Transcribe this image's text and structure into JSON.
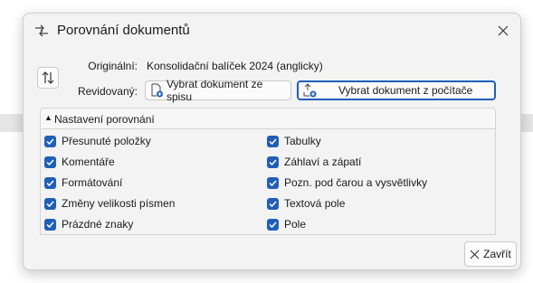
{
  "dialog": {
    "title": "Porovnání dokumentů",
    "title_icon": "compare-arrows-icon",
    "close_icon": "close-icon"
  },
  "documents": {
    "original_label": "Originální:",
    "original_value": "Konsolidační balíček 2024 (anglicky)",
    "revised_label": "Revidovaný:",
    "from_file_button": "Vybrat dokument ze spisu",
    "from_computer_button": "Vybrat dokument z počítače",
    "swap_icon": "swap-vertical-icon"
  },
  "settings": {
    "header": "Nastavení porovnání",
    "expanded_glyph": "▲",
    "left_options": [
      {
        "label": "Přesunuté položky",
        "checked": true
      },
      {
        "label": "Komentáře",
        "checked": true
      },
      {
        "label": "Formátování",
        "checked": true
      },
      {
        "label": "Změny velikosti písmen",
        "checked": true
      },
      {
        "label": "Prázdné znaky",
        "checked": true
      }
    ],
    "right_options": [
      {
        "label": "Tabulky",
        "checked": true
      },
      {
        "label": "Záhlaví a zápatí",
        "checked": true
      },
      {
        "label": "Pozn. pod čarou a vysvětlivky",
        "checked": true
      },
      {
        "label": "Textová pole",
        "checked": true
      },
      {
        "label": "Pole",
        "checked": true
      }
    ]
  },
  "footer": {
    "close_button": "Zavřít"
  },
  "colors": {
    "accent": "#1f5fb8",
    "dialog_bg": "#f3f3f3"
  }
}
